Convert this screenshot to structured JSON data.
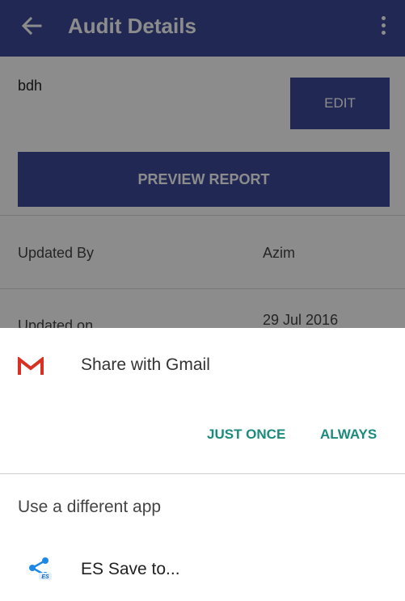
{
  "toolbar": {
    "title": "Audit Details",
    "color": "#3c4a9a"
  },
  "audit": {
    "name": "bdh",
    "edit_label": "EDIT",
    "preview_label": "PREVIEW REPORT",
    "rows": [
      {
        "label": "Updated By",
        "value": "Azim"
      },
      {
        "label": "Updated on",
        "value": "29 Jul 2016"
      }
    ]
  },
  "chooser": {
    "default_app": {
      "icon": "gmail-icon",
      "label": "Share with Gmail"
    },
    "just_once_label": "JUST ONCE",
    "always_label": "ALWAYS",
    "accent": "#1b8b7e",
    "other_header": "Use a different app",
    "apps": [
      {
        "icon": "es-share-icon",
        "label": "ES Save to..."
      }
    ]
  }
}
